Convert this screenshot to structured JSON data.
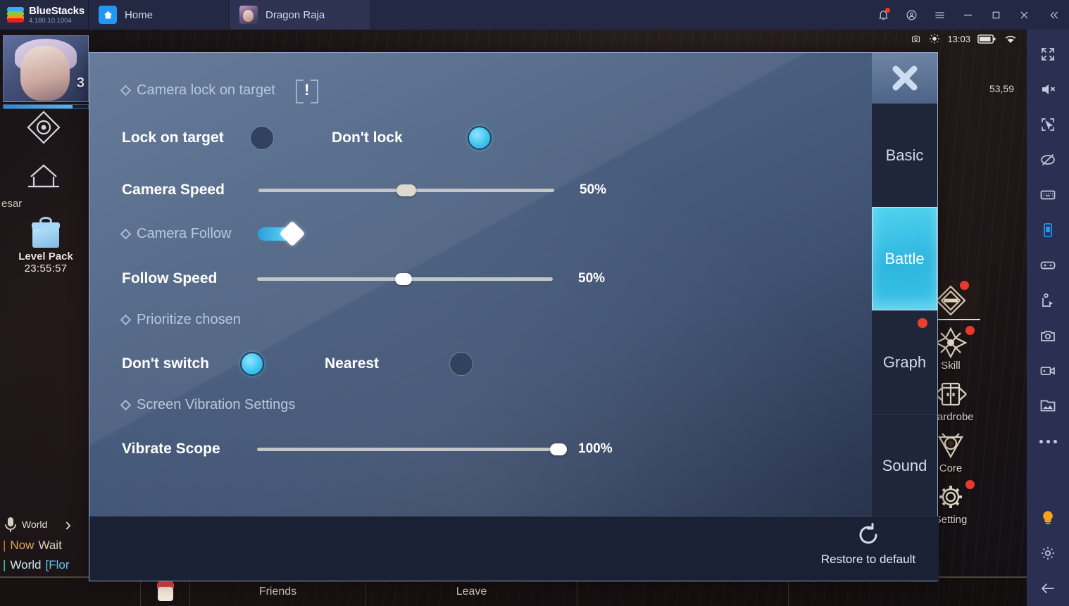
{
  "window": {
    "brand": "BlueStacks",
    "version": "4.180.10.1004",
    "tabs": [
      {
        "label": "Home",
        "icon": "home-icon",
        "active": false
      },
      {
        "label": "Dragon Raja",
        "icon": "game-thumbnail",
        "active": true
      }
    ],
    "controls": [
      {
        "name": "notifications",
        "icon": "bell-icon",
        "badge": true
      },
      {
        "name": "account",
        "icon": "account-circle-icon"
      },
      {
        "name": "menu",
        "icon": "hamburger-menu-icon"
      },
      {
        "name": "minimize",
        "icon": "minimize-icon"
      },
      {
        "name": "maximize",
        "icon": "maximize-icon"
      },
      {
        "name": "close",
        "icon": "close-icon"
      },
      {
        "name": "collapse",
        "icon": "double-chevron-left-icon"
      }
    ]
  },
  "android_status": {
    "time": "13:03",
    "coordinates": "53,59"
  },
  "game_hud": {
    "player_level": "3",
    "npc_name": "esar",
    "event_title": "Level Pack",
    "event_timer": "23:55:57",
    "chat_channel": "World",
    "chat_lines": [
      {
        "channel": "Now",
        "text": "Wait"
      },
      {
        "channel": "World",
        "text": "[Flor"
      }
    ],
    "menu": [
      {
        "label": "",
        "icon": "diamond-bag-icon",
        "badge": true
      },
      {
        "label": "Skill",
        "icon": "skill-star-icon",
        "badge": true
      },
      {
        "label": "Wardrobe",
        "icon": "wardrobe-icon",
        "badge": false
      },
      {
        "label": "Core",
        "icon": "core-icon",
        "badge": false
      },
      {
        "label": "Setting",
        "icon": "gear-icon",
        "badge": true
      }
    ],
    "bottom_bar": [
      "Friends",
      "Leave"
    ]
  },
  "dialog": {
    "close_label": "X",
    "tabs": [
      {
        "label": "Basic",
        "active": false,
        "badge": false
      },
      {
        "label": "Battle",
        "active": true,
        "badge": false
      },
      {
        "label": "Graph",
        "active": false,
        "badge": true
      },
      {
        "label": "Sound",
        "active": false,
        "badge": false
      }
    ],
    "sections": [
      {
        "title": "Camera lock on target",
        "info_badge": "!",
        "radio_group": {
          "options": [
            {
              "label": "Lock on target",
              "selected": false
            },
            {
              "label": "Don't lock",
              "selected": true
            }
          ]
        },
        "slider": {
          "label": "Camera Speed",
          "value": 50,
          "value_text": "50%"
        }
      },
      {
        "title": "Camera Follow",
        "toggle": {
          "on": true
        },
        "slider": {
          "label": "Follow Speed",
          "value": 50,
          "value_text": "50%"
        }
      },
      {
        "title": "Prioritize chosen",
        "radio_group": {
          "options": [
            {
              "label": "Don't switch",
              "selected": true
            },
            {
              "label": "Nearest",
              "selected": false
            }
          ]
        }
      },
      {
        "title": "Screen Vibration Settings",
        "slider": {
          "label": "Vibrate Scope",
          "value": 100,
          "value_text": "100%"
        }
      }
    ],
    "restore": {
      "label": "Restore to default",
      "icon": "refresh-icon"
    }
  },
  "sidebar": {
    "items": [
      {
        "name": "fullscreen-icon",
        "active": false
      },
      {
        "name": "mute-icon",
        "active": false
      },
      {
        "name": "cursor-capture-icon",
        "active": false
      },
      {
        "name": "eye-off-icon",
        "active": false
      },
      {
        "name": "keyboard-icon",
        "active": false
      },
      {
        "name": "rotate-screen-icon",
        "active": true
      },
      {
        "name": "gamepad-icon",
        "active": false
      },
      {
        "name": "macro-icon",
        "active": false
      },
      {
        "name": "screenshot-icon",
        "active": false
      },
      {
        "name": "record-video-icon",
        "active": false
      },
      {
        "name": "media-gallery-icon",
        "active": false
      },
      {
        "name": "more-options-icon",
        "active": false
      },
      {
        "name": "lightbulb-icon",
        "active": false
      },
      {
        "name": "settings-gear-icon",
        "active": false
      },
      {
        "name": "back-arrow-icon",
        "active": false
      }
    ]
  },
  "colors": {
    "accent": "#3cc3ef",
    "brand": "#2196f3",
    "badge": "#ef3d2e",
    "bulb": "#f5a31c"
  }
}
